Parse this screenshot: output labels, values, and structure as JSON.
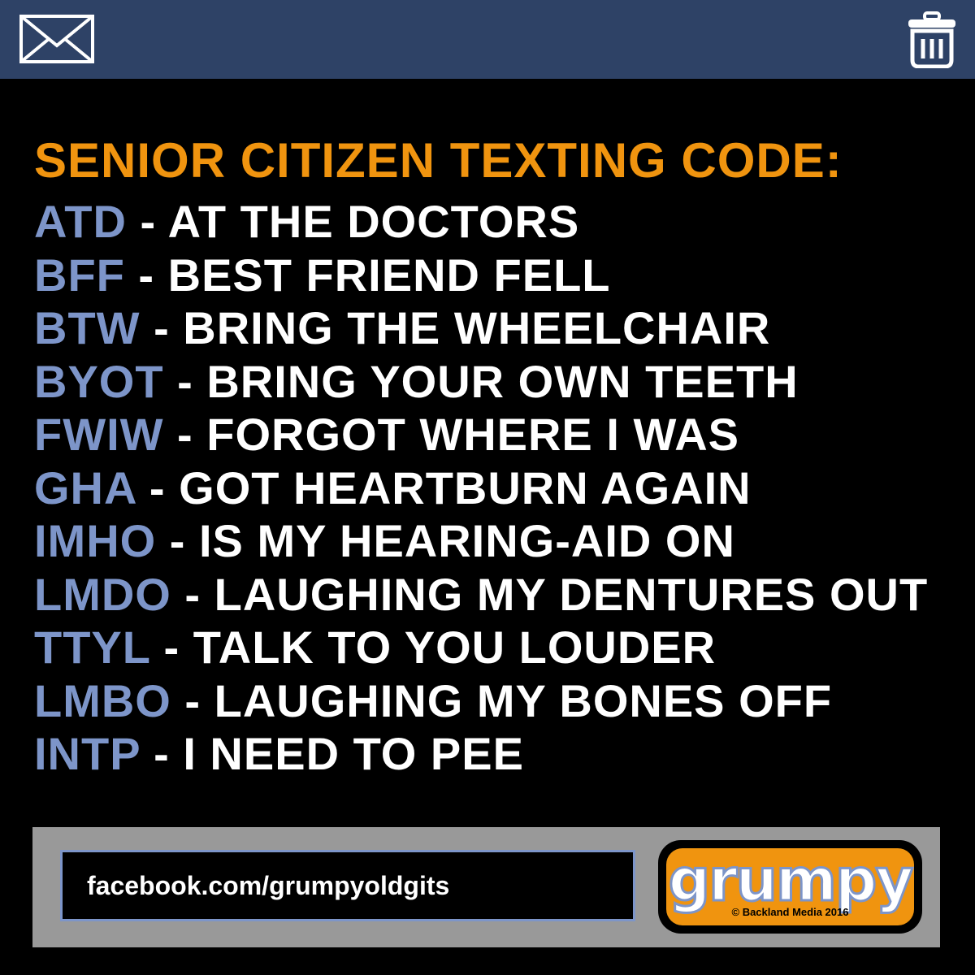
{
  "header": {
    "mail_icon": "envelope-icon",
    "trash_icon": "trash-can-icon",
    "bar_color": "#2e4266"
  },
  "title": "SENIOR CITIZEN TEXTING CODE:",
  "colors": {
    "title": "#f0940f",
    "abbreviation": "#7d95c9",
    "meaning": "#ffffff",
    "background": "#000000"
  },
  "codes": [
    {
      "abbr": "ATD",
      "meaning": " - AT THE DOCTORS"
    },
    {
      "abbr": "BFF",
      "meaning": " - BEST FRIEND FELL"
    },
    {
      "abbr": "BTW",
      "meaning": " - BRING THE WHEELCHAIR"
    },
    {
      "abbr": "BYOT",
      "meaning": " - BRING YOUR OWN TEETH"
    },
    {
      "abbr": "FWIW",
      "meaning": " - FORGOT WHERE I WAS"
    },
    {
      "abbr": "GHA",
      "meaning": " - GOT HEARTBURN AGAIN"
    },
    {
      "abbr": "IMHO",
      "meaning": " - IS MY HEARING-AID ON"
    },
    {
      "abbr": "LMDO",
      "meaning": " - LAUGHING MY DENTURES OUT"
    },
    {
      "abbr": "TTYL",
      "meaning": " - TALK TO YOU LOUDER"
    },
    {
      "abbr": "LMBO",
      "meaning": " - LAUGHING MY BONES OFF"
    },
    {
      "abbr": "INTP",
      "meaning": " - I NEED TO PEE"
    }
  ],
  "footer": {
    "link_text": "facebook.com/grumpyoldgits",
    "logo_word": "grumpy",
    "logo_copyright": "© Backland Media 2016"
  }
}
